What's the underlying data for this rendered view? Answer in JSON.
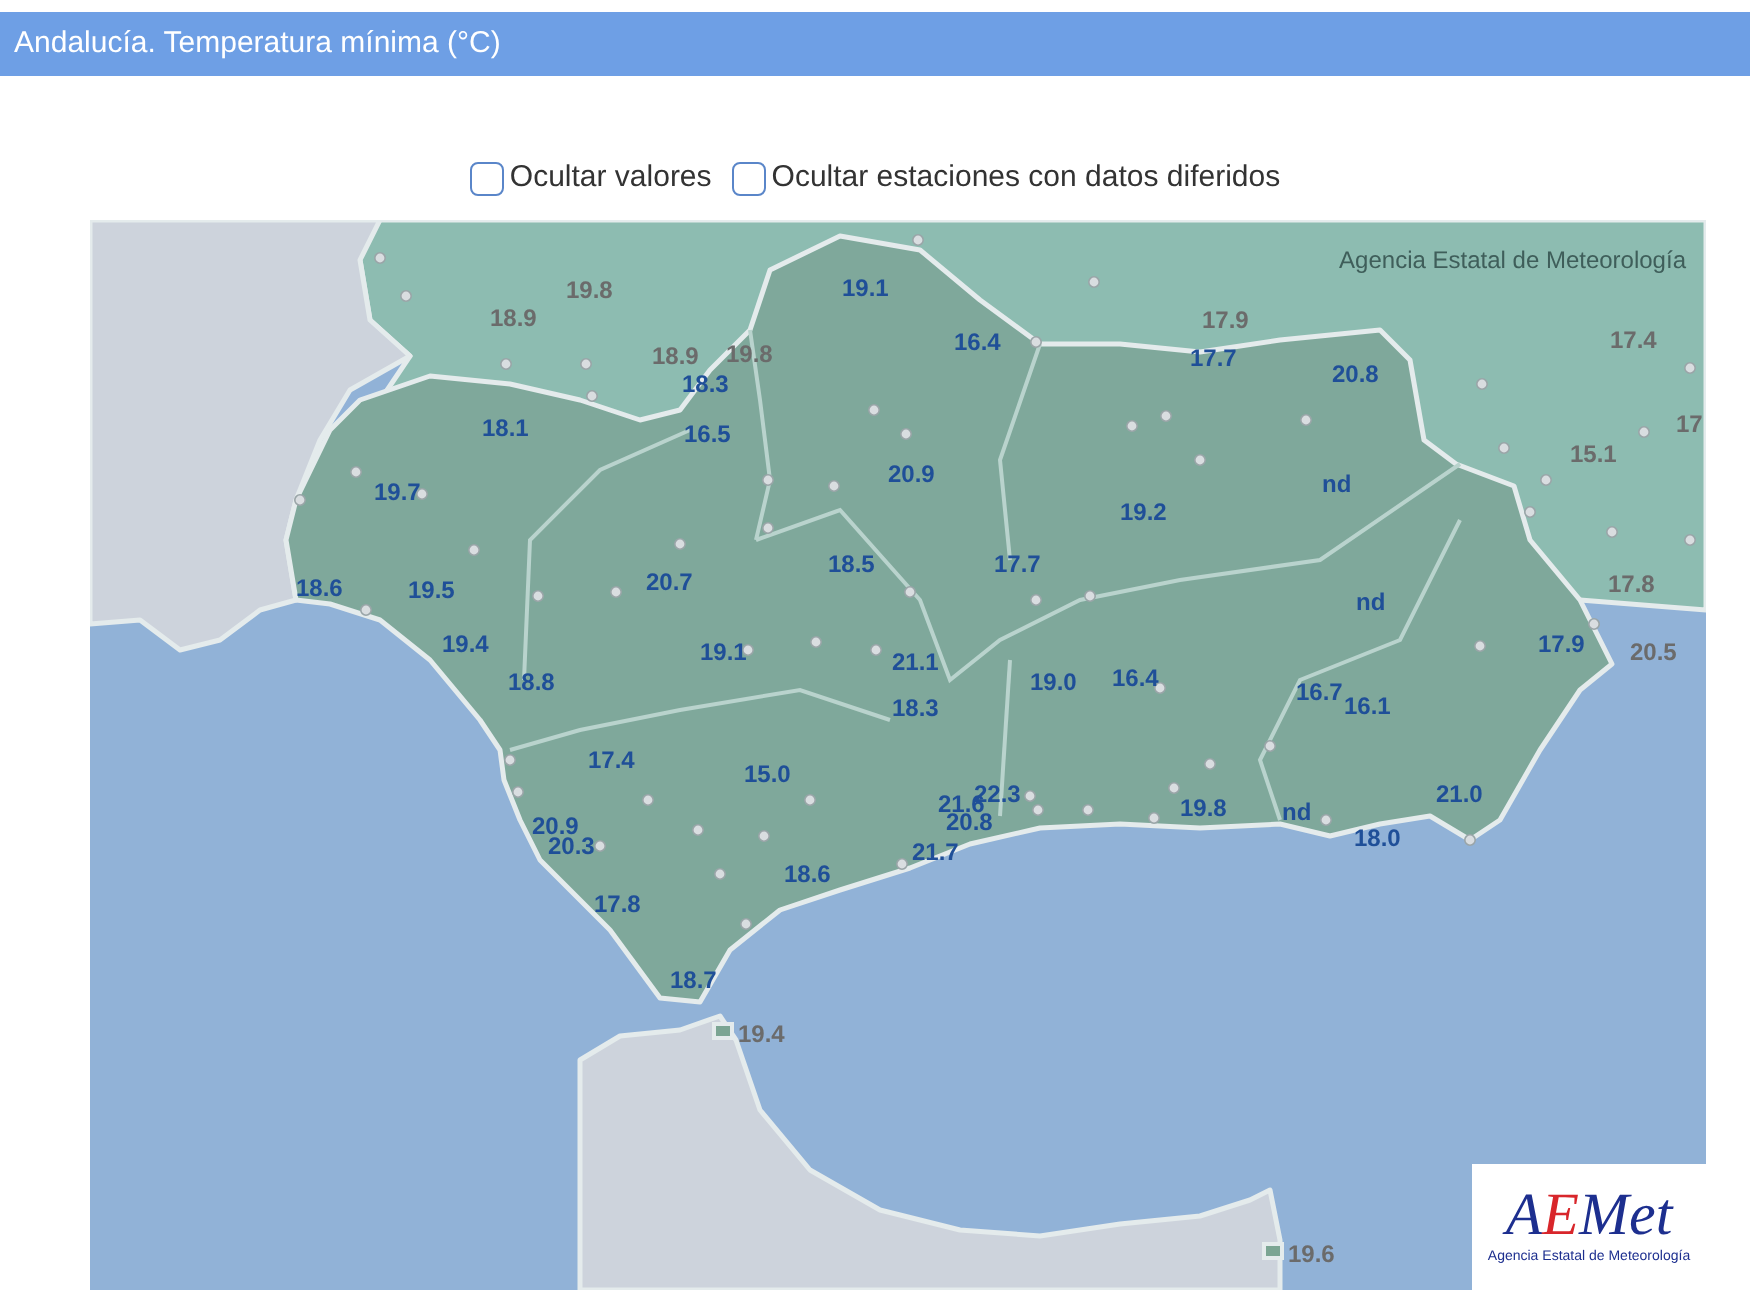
{
  "header": {
    "title": "Andalucía. Temperatura mínima (°C)"
  },
  "options": [
    {
      "label": "Ocultar valores",
      "checked": false
    },
    {
      "label": "Ocultar estaciones con datos diferidos",
      "checked": false
    }
  ],
  "map": {
    "attribution": "Agencia Estatal de Meteorología",
    "stations": [
      {
        "value": "19.8",
        "kind": "outside"
      },
      {
        "value": "19.1",
        "kind": "andalucia"
      },
      {
        "value": "18.9",
        "kind": "outside"
      },
      {
        "value": "17.9",
        "kind": "outside"
      },
      {
        "value": "16.4",
        "kind": "andalucia"
      },
      {
        "value": "17.4",
        "kind": "outside"
      },
      {
        "value": "18.9",
        "kind": "outside"
      },
      {
        "value": "19.8",
        "kind": "outside"
      },
      {
        "value": "17.7",
        "kind": "andalucia"
      },
      {
        "value": "20.8",
        "kind": "andalucia"
      },
      {
        "value": "18.3",
        "kind": "andalucia"
      },
      {
        "value": "18.1",
        "kind": "andalucia"
      },
      {
        "value": "16.5",
        "kind": "andalucia"
      },
      {
        "value": "17",
        "kind": "outside"
      },
      {
        "value": "15.1",
        "kind": "outside"
      },
      {
        "value": "20.9",
        "kind": "andalucia"
      },
      {
        "value": "nd",
        "kind": "andalucia"
      },
      {
        "value": "19.7",
        "kind": "andalucia"
      },
      {
        "value": "19.2",
        "kind": "andalucia"
      },
      {
        "value": "18.5",
        "kind": "andalucia"
      },
      {
        "value": "17.7",
        "kind": "andalucia"
      },
      {
        "value": "18.6",
        "kind": "andalucia"
      },
      {
        "value": "19.5",
        "kind": "andalucia"
      },
      {
        "value": "20.7",
        "kind": "andalucia"
      },
      {
        "value": "17.8",
        "kind": "outside"
      },
      {
        "value": "nd",
        "kind": "andalucia"
      },
      {
        "value": "19.4",
        "kind": "andalucia"
      },
      {
        "value": "19.1",
        "kind": "andalucia"
      },
      {
        "value": "17.9",
        "kind": "andalucia"
      },
      {
        "value": "20.5",
        "kind": "outside"
      },
      {
        "value": "21.1",
        "kind": "andalucia"
      },
      {
        "value": "18.8",
        "kind": "andalucia"
      },
      {
        "value": "19.0",
        "kind": "andalucia"
      },
      {
        "value": "16.4",
        "kind": "andalucia"
      },
      {
        "value": "16.7",
        "kind": "andalucia"
      },
      {
        "value": "16.1",
        "kind": "andalucia"
      },
      {
        "value": "18.3",
        "kind": "andalucia"
      },
      {
        "value": "17.4",
        "kind": "andalucia"
      },
      {
        "value": "15.0",
        "kind": "andalucia"
      },
      {
        "value": "21.6",
        "kind": "andalucia"
      },
      {
        "value": "22.3",
        "kind": "andalucia"
      },
      {
        "value": "19.8",
        "kind": "andalucia"
      },
      {
        "value": "nd",
        "kind": "andalucia"
      },
      {
        "value": "21.0",
        "kind": "andalucia"
      },
      {
        "value": "20.9",
        "kind": "andalucia"
      },
      {
        "value": "20.8",
        "kind": "andalucia"
      },
      {
        "value": "20.3",
        "kind": "andalucia"
      },
      {
        "value": "21.7",
        "kind": "andalucia"
      },
      {
        "value": "18.0",
        "kind": "andalucia"
      },
      {
        "value": "18.6",
        "kind": "andalucia"
      },
      {
        "value": "17.8",
        "kind": "andalucia"
      },
      {
        "value": "18.7",
        "kind": "andalucia"
      },
      {
        "value": "19.4",
        "kind": "enclave"
      },
      {
        "value": "19.6",
        "kind": "enclave"
      }
    ]
  },
  "logo": {
    "wordmark": "AEMet",
    "subtitle": "Agencia Estatal de Meteorología"
  }
}
